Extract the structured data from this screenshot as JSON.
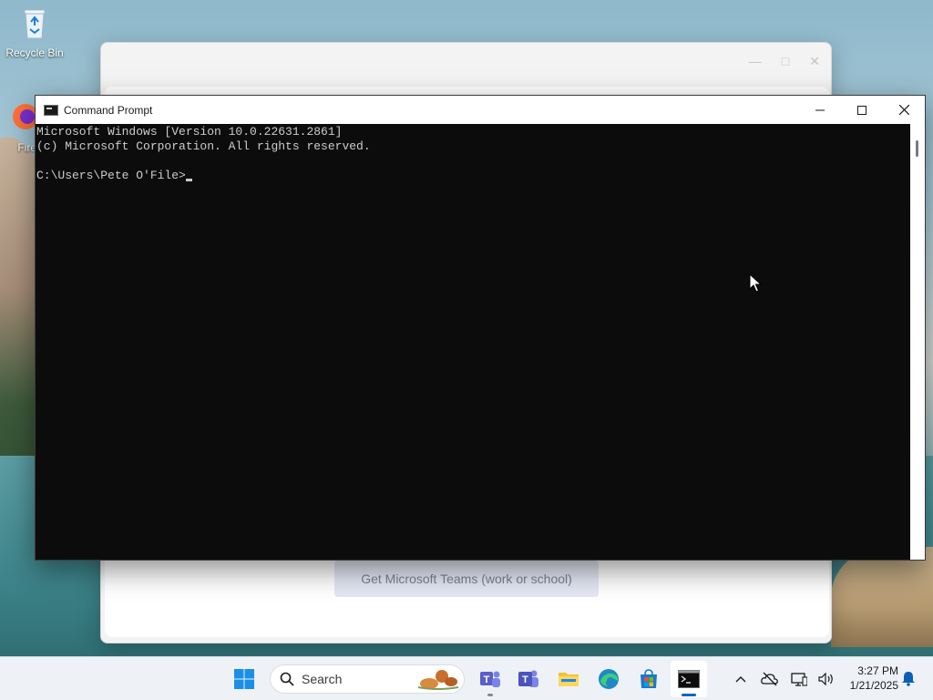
{
  "desktop": {
    "icons": [
      {
        "label": "Recycle Bin",
        "icon": "recycle-bin-icon"
      },
      {
        "label": "Fire",
        "icon": "firefox-icon"
      }
    ]
  },
  "background_window": {
    "app": "Microsoft Teams",
    "teams_button": "Get Microsoft Teams (work or school)"
  },
  "cmd": {
    "title": "Command Prompt",
    "lines": [
      "Microsoft Windows [Version 10.0.22631.2861]",
      "(c) Microsoft Corporation. All rights reserved.",
      "",
      "C:\\Users\\Pete O'File>"
    ],
    "controls": {
      "minimize": "minimize-icon",
      "maximize": "maximize-icon",
      "close": "close-icon"
    }
  },
  "taskbar": {
    "search_placeholder": "Search",
    "apps": [
      {
        "name": "start",
        "icon": "windows-start-icon"
      },
      {
        "name": "teams-chat",
        "icon": "teams-chat-icon"
      },
      {
        "name": "teams",
        "icon": "teams-icon"
      },
      {
        "name": "file-explorer",
        "icon": "folder-icon"
      },
      {
        "name": "edge",
        "icon": "edge-icon"
      },
      {
        "name": "microsoft-store",
        "icon": "store-icon"
      },
      {
        "name": "terminal",
        "icon": "terminal-icon",
        "active": true
      }
    ],
    "tray_icons": [
      "chevron-up-icon",
      "onedrive-offline-icon",
      "network-icon",
      "volume-icon"
    ],
    "time": "3:27 PM",
    "date": "1/21/2025"
  },
  "colors": {
    "console_bg": "#0c0c0c",
    "console_text": "#cccccc",
    "accent": "#0067c0"
  }
}
